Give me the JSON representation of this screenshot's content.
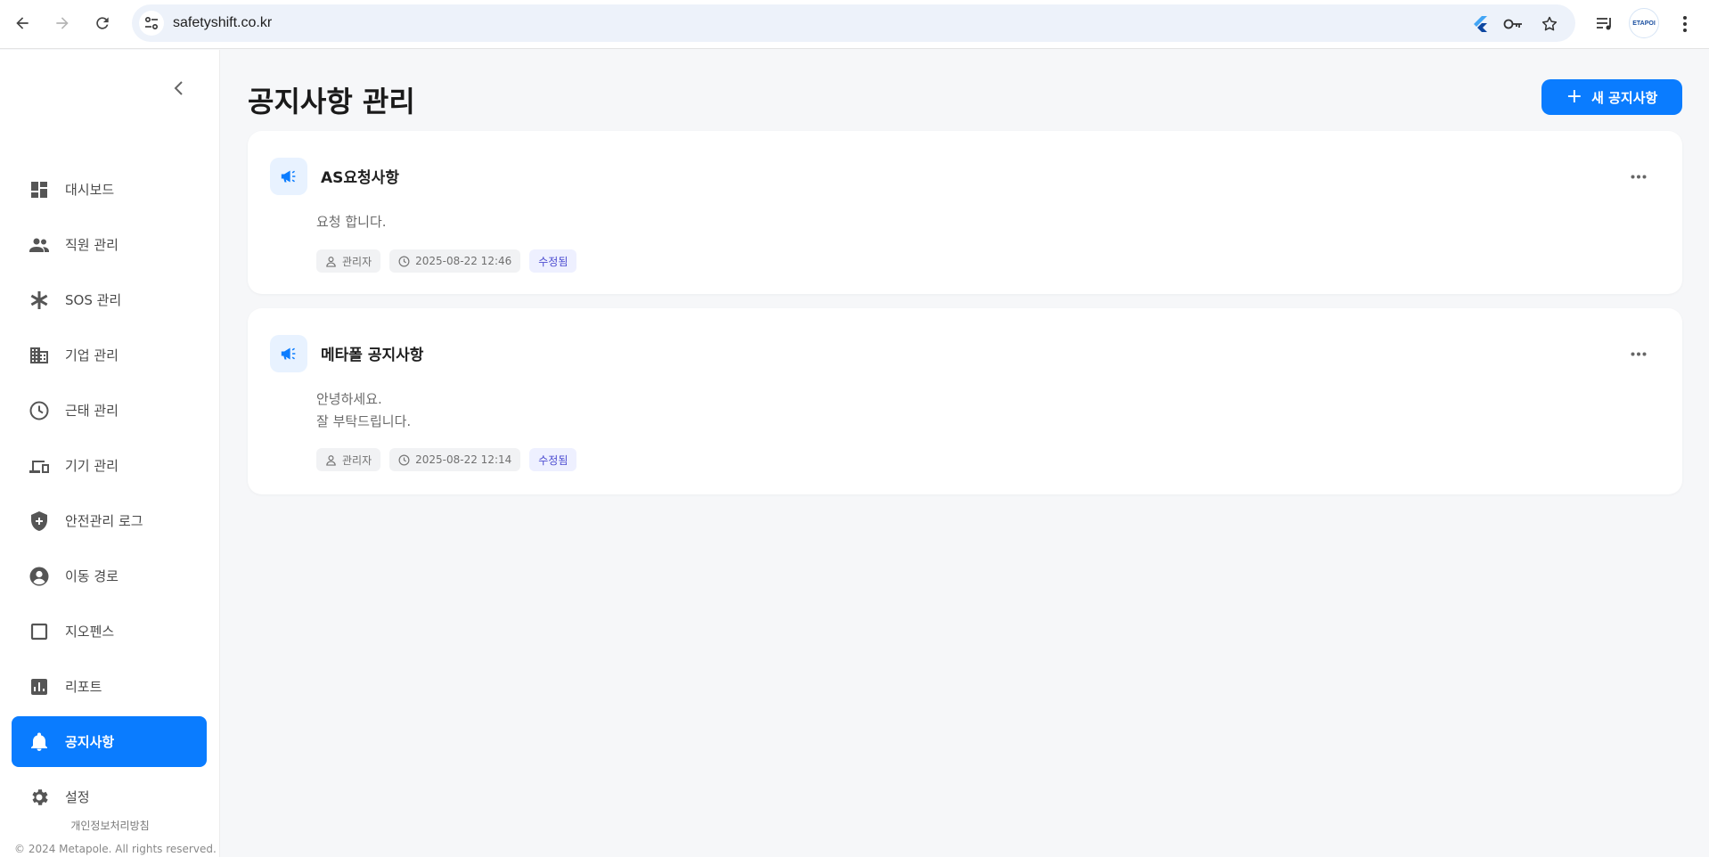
{
  "browser": {
    "url": "safetyshift.co.kr",
    "profile_label": "ETAPOI"
  },
  "sidebar": {
    "items": [
      {
        "label": "대시보드",
        "icon": "dashboard-icon"
      },
      {
        "label": "직원 관리",
        "icon": "people-icon"
      },
      {
        "label": "SOS 관리",
        "icon": "asterisk-icon"
      },
      {
        "label": "기업 관리",
        "icon": "building-icon"
      },
      {
        "label": "근태 관리",
        "icon": "clock-icon"
      },
      {
        "label": "기기 관리",
        "icon": "devices-icon"
      },
      {
        "label": "안전관리 로그",
        "icon": "shield-icon"
      },
      {
        "label": "이동 경로",
        "icon": "account-circle-icon"
      },
      {
        "label": "지오펜스",
        "icon": "square-icon"
      },
      {
        "label": "리포트",
        "icon": "bar-chart-icon"
      },
      {
        "label": "공지사항",
        "icon": "bell-icon"
      },
      {
        "label": "설정",
        "icon": "gear-icon"
      }
    ],
    "active_index": 10,
    "privacy_link": "개인정보처리방침",
    "copyright": "© 2024 Metapole. All rights reserved."
  },
  "main": {
    "title": "공지사항 관리",
    "new_button_label": "새 공지사항",
    "notices": [
      {
        "title": "AS요청사항",
        "body_lines": [
          "요청 합니다."
        ],
        "author": "관리자",
        "datetime": "2025-08-22 12:46",
        "status": "수정됨"
      },
      {
        "title": "메타폴 공지사항",
        "body_lines": [
          "안녕하세요.",
          "잘 부탁드립니다."
        ],
        "author": "관리자",
        "datetime": "2025-08-22 12:14",
        "status": "수정됨"
      }
    ]
  },
  "colors": {
    "accent": "#0a7cff",
    "edited_badge_text": "#4a4ad0",
    "edited_badge_bg": "#eef0ff"
  }
}
